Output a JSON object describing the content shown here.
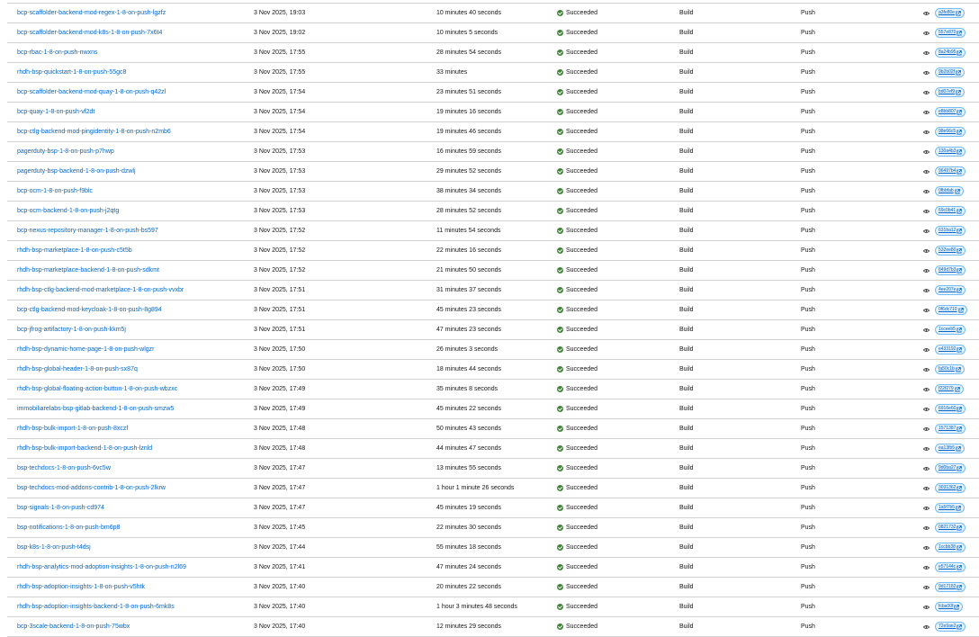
{
  "rows": [
    {
      "name": "bcp-scaffolder-backend-mod-regex-1-8-on-push-lgzfz",
      "started": "3 Nov 2025, 19:03",
      "duration": "10 minutes 40 seconds",
      "status": "Succeeded",
      "type": "Build",
      "trigger": "Push",
      "sha": "a3fe80e"
    },
    {
      "name": "bcp-scaffolder-backend-mod-k8s-1-8-on-push-7x6t4",
      "started": "3 Nov 2025, 19:02",
      "duration": "10 minutes 5 seconds",
      "status": "Succeeded",
      "type": "Build",
      "trigger": "Push",
      "sha": "557e870"
    },
    {
      "name": "bcp-rbac-1-8-on-push-nwxns",
      "started": "3 Nov 2025, 17:55",
      "duration": "28 minutes 54 seconds",
      "status": "Succeeded",
      "type": "Build",
      "trigger": "Push",
      "sha": "8a24b95"
    },
    {
      "name": "rhdh-bsp-quickstart-1-8-on-push-55gc8",
      "started": "3 Nov 2025, 17:55",
      "duration": "33 minutes",
      "status": "Succeeded",
      "type": "Build",
      "trigger": "Push",
      "sha": "9b2b02f"
    },
    {
      "name": "bcp-scaffolder-backend-mod-quay-1-8-on-push-q42zl",
      "started": "3 Nov 2025, 17:54",
      "duration": "23 minutes 51 seconds",
      "status": "Succeeded",
      "type": "Build",
      "trigger": "Push",
      "sha": "bd07ef9"
    },
    {
      "name": "bcp-quay-1-8-on-push-vf2dt",
      "started": "3 Nov 2025, 17:54",
      "duration": "19 minutes 16 seconds",
      "status": "Succeeded",
      "type": "Build",
      "trigger": "Push",
      "sha": "e8bb807"
    },
    {
      "name": "bcp-ctlg-backend-mod-pingidentity-1-8-on-push-n2mb6",
      "started": "3 Nov 2025, 17:54",
      "duration": "19 minutes 46 seconds",
      "status": "Succeeded",
      "type": "Build",
      "trigger": "Push",
      "sha": "98e66c5"
    },
    {
      "name": "pagerduty-bsp-1-8-on-push-p7hwp",
      "started": "3 Nov 2025, 17:53",
      "duration": "16 minutes 59 seconds",
      "status": "Succeeded",
      "type": "Build",
      "trigger": "Push",
      "sha": "130a4b3"
    },
    {
      "name": "pagerduty-bsp-backend-1-8-on-push-dzwlj",
      "started": "3 Nov 2025, 17:53",
      "duration": "29 minutes 52 seconds",
      "status": "Succeeded",
      "type": "Build",
      "trigger": "Push",
      "sha": "96497b4"
    },
    {
      "name": "bcp-ocm-1-8-on-push-f9blc",
      "started": "3 Nov 2025, 17:53",
      "duration": "38 minutes 34 seconds",
      "status": "Succeeded",
      "type": "Build",
      "trigger": "Push",
      "sha": "0fbbfab"
    },
    {
      "name": "bcp-ocm-backend-1-8-on-push-j2qtg",
      "started": "3 Nov 2025, 17:53",
      "duration": "28 minutes 52 seconds",
      "status": "Succeeded",
      "type": "Build",
      "trigger": "Push",
      "sha": "69c0b41"
    },
    {
      "name": "bcp-nexus-repository-manager-1-8-on-push-bs597",
      "started": "3 Nov 2025, 17:52",
      "duration": "11 minutes 54 seconds",
      "status": "Succeeded",
      "type": "Build",
      "trigger": "Push",
      "sha": "631ba12"
    },
    {
      "name": "rhdh-bsp-marketplace-1-8-on-push-c5t5b",
      "started": "3 Nov 2025, 17:52",
      "duration": "22 minutes 16 seconds",
      "status": "Succeeded",
      "type": "Build",
      "trigger": "Push",
      "sha": "532ee80"
    },
    {
      "name": "rhdh-bsp-marketplace-backend-1-8-on-push-sdkmt",
      "started": "3 Nov 2025, 17:52",
      "duration": "21 minutes 50 seconds",
      "status": "Succeeded",
      "type": "Build",
      "trigger": "Push",
      "sha": "849d7b3"
    },
    {
      "name": "rhdh-bsp-ctlg-backend-mod-marketplace-1-8-on-push-vvxbr",
      "started": "3 Nov 2025, 17:51",
      "duration": "31 minutes 37 seconds",
      "status": "Succeeded",
      "type": "Build",
      "trigger": "Push",
      "sha": "4ee207e"
    },
    {
      "name": "bcp-ctlg-backend-mod-keycloak-1-8-on-push-8g894",
      "started": "3 Nov 2025, 17:51",
      "duration": "45 minutes 23 seconds",
      "status": "Succeeded",
      "type": "Build",
      "trigger": "Push",
      "sha": "0f6dc710"
    },
    {
      "name": "bcp-jfrog-artifactory-1-8-on-push-kkm5j",
      "started": "3 Nov 2025, 17:51",
      "duration": "47 minutes 23 seconds",
      "status": "Succeeded",
      "type": "Build",
      "trigger": "Push",
      "sha": "1cceeb5"
    },
    {
      "name": "rhdh-bsp-dynamic-home-page-1-8-on-push-wlgzr",
      "started": "3 Nov 2025, 17:50",
      "duration": "26 minutes 3 seconds",
      "status": "Succeeded",
      "type": "Build",
      "trigger": "Push",
      "sha": "e433192"
    },
    {
      "name": "rhdh-bsp-global-header-1-8-on-push-sx87q",
      "started": "3 Nov 2025, 17:50",
      "duration": "18 minutes 44 seconds",
      "status": "Succeeded",
      "type": "Build",
      "trigger": "Push",
      "sha": "fa50c1b"
    },
    {
      "name": "rhdh-bsp-global-floating-action-button-1-8-on-push-wbzxc",
      "started": "3 Nov 2025, 17:49",
      "duration": "35 minutes 8 seconds",
      "status": "Succeeded",
      "type": "Build",
      "trigger": "Push",
      "sha": "f22f279"
    },
    {
      "name": "immobiliarelabs-bsp-gitlab-backend-1-8-on-push-smzw5",
      "started": "3 Nov 2025, 17:49",
      "duration": "45 minutes 22 seconds",
      "status": "Succeeded",
      "type": "Build",
      "trigger": "Push",
      "sha": "6916e60"
    },
    {
      "name": "rhdh-bsp-bulk-import-1-8-on-push-8xczf",
      "started": "3 Nov 2025, 17:48",
      "duration": "50 minutes 43 seconds",
      "status": "Succeeded",
      "type": "Build",
      "trigger": "Push",
      "sha": "1571387"
    },
    {
      "name": "rhdh-bsp-bulk-import-backend-1-8-on-push-lznld",
      "started": "3 Nov 2025, 17:48",
      "duration": "44 minutes 47 seconds",
      "status": "Succeeded",
      "type": "Build",
      "trigger": "Push",
      "sha": "ea13fb5"
    },
    {
      "name": "bsp-techdocs-1-8-on-push-6vc5w",
      "started": "3 Nov 2025, 17:47",
      "duration": "13 minutes 55 seconds",
      "status": "Succeeded",
      "type": "Build",
      "trigger": "Push",
      "sha": "9d0ba27"
    },
    {
      "name": "bsp-techdocs-mod-addons-contrib-1-8-on-push-2lkrw",
      "started": "3 Nov 2025, 17:47",
      "duration": "1 hour 1 minute 26 seconds",
      "status": "Succeeded",
      "type": "Build",
      "trigger": "Push",
      "sha": "3031362"
    },
    {
      "name": "bsp-signals-1-8-on-push-cd974",
      "started": "3 Nov 2025, 17:47",
      "duration": "45 minutes 19 seconds",
      "status": "Succeeded",
      "type": "Build",
      "trigger": "Push",
      "sha": "1a5f7b5"
    },
    {
      "name": "bsp-notifications-1-8-on-push-bm6p8",
      "started": "3 Nov 2025, 17:45",
      "duration": "22 minutes 30 seconds",
      "status": "Succeeded",
      "type": "Build",
      "trigger": "Push",
      "sha": "0821732"
    },
    {
      "name": "bsp-k8s-1-8-on-push-t4dsj",
      "started": "3 Nov 2025, 17:44",
      "duration": "55 minutes 18 seconds",
      "status": "Succeeded",
      "type": "Build",
      "trigger": "Push",
      "sha": "1ccbb38"
    },
    {
      "name": "rhdh-bsp-analytics-mod-adoption-insights-1-8-on-push-n2l69",
      "started": "3 Nov 2025, 17:41",
      "duration": "47 minutes 24 seconds",
      "status": "Succeeded",
      "type": "Build",
      "trigger": "Push",
      "sha": "e57144c"
    },
    {
      "name": "rhdh-bsp-adoption-insights-1-8-on-push-v5htk",
      "started": "3 Nov 2025, 17:40",
      "duration": "20 minutes 22 seconds",
      "status": "Succeeded",
      "type": "Build",
      "trigger": "Push",
      "sha": "9d17182"
    },
    {
      "name": "rhdh-bsp-adoption-insights-backend-1-8-on-push-6mk8s",
      "started": "3 Nov 2025, 17:40",
      "duration": "1 hour 3 minutes 48 seconds",
      "status": "Succeeded",
      "type": "Build",
      "trigger": "Push",
      "sha": "fcba00f"
    },
    {
      "name": "bcp-3scale-backend-1-8-on-push-75wbx",
      "started": "3 Nov 2025, 17:40",
      "duration": "12 minutes 29 seconds",
      "status": "Succeeded",
      "type": "Build",
      "trigger": "Push",
      "sha": "72e9ae2"
    }
  ],
  "colors": {
    "link": "#0066cc",
    "success": "#3e8635",
    "border": "#d2d2d2",
    "badge_bg": "#e7f1fa",
    "badge_border": "#73bcf7"
  },
  "icons": {
    "status": "check-circle-icon",
    "action": "eye-icon",
    "external": "external-link-icon"
  }
}
